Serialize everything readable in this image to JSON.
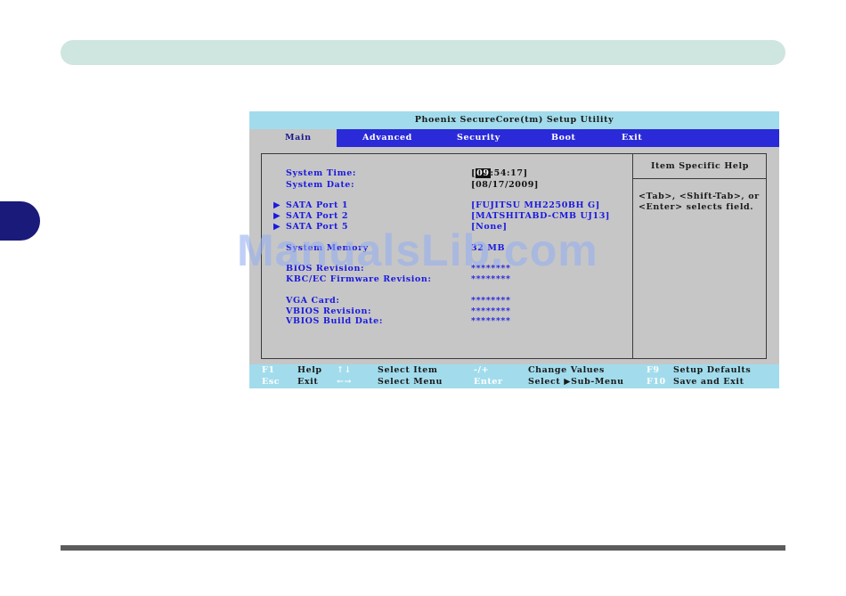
{
  "bios": {
    "title": "Phoenix SecureCore(tm) Setup Utility",
    "tabs": [
      {
        "label": "Main"
      },
      {
        "label": "Advanced"
      },
      {
        "label": "Security"
      },
      {
        "label": "Boot"
      },
      {
        "label": "Exit"
      }
    ],
    "help_header": "Item Specific Help",
    "help_text": "<Tab>, <Shift-Tab>, or <Enter> selects field.",
    "fields": {
      "system_time": {
        "label": "System Time:",
        "value_cursor": "09",
        "value_rest": ":54:17]",
        "value_open": "["
      },
      "system_date": {
        "label": "System Date:",
        "value": "[08/17/2009]"
      },
      "sata1": {
        "label": "SATA Port 1",
        "value": "[FUJITSU MH2250BH G]"
      },
      "sata2": {
        "label": "SATA Port 2",
        "value": "[MATSHITABD-CMB UJ13]"
      },
      "sata5": {
        "label": "SATA Port 5",
        "value": "[None]"
      },
      "system_memory": {
        "label": "System Memory",
        "value": "32 MB"
      },
      "bios_revision": {
        "label": "BIOS Revision:",
        "value": "********"
      },
      "kbc_revision": {
        "label": "KBC/EC Firmware Revision:",
        "value": "********"
      },
      "vga_card": {
        "label": "VGA Card:",
        "value": "********"
      },
      "vbios_revision": {
        "label": "VBIOS Revision:",
        "value": "********"
      },
      "vbios_date": {
        "label": "VBIOS Build Date:",
        "value": "********"
      }
    },
    "footer": {
      "f1": "F1",
      "help": "Help",
      "updown": "↑↓",
      "select_item": "Select Item",
      "minusplus": "-/+",
      "change_values": "Change Values",
      "f9": "F9",
      "setup_defaults": "Setup Defaults",
      "esc": "Esc",
      "exit": "Exit",
      "leftright": "←→",
      "select_menu": "Select Menu",
      "enter": "Enter",
      "select_submenu": "Select ▶Sub-Menu",
      "f10": "F10",
      "save_exit": "Save and Exit"
    }
  },
  "watermark": "ManualsLib.com"
}
